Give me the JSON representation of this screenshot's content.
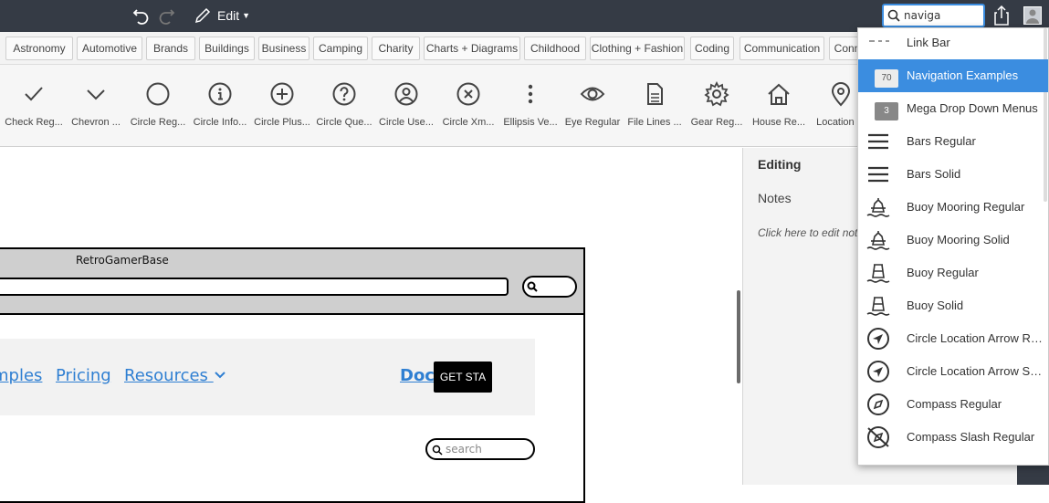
{
  "toolbar": {
    "edit_label": "Edit",
    "search_value": "naviga"
  },
  "categories": [
    "Astronomy",
    "Automotive",
    "Brands",
    "Buildings",
    "Business",
    "Camping",
    "Charity",
    "Charts + Diagrams",
    "Childhood",
    "Clothing + Fashion",
    "Coding",
    "Communication",
    "Conn"
  ],
  "icons": [
    {
      "label": "Check Reg...",
      "icon": "check-icon"
    },
    {
      "label": "Chevron ...",
      "icon": "chevron-down-icon"
    },
    {
      "label": "Circle Reg...",
      "icon": "circle-icon"
    },
    {
      "label": "Circle Info...",
      "icon": "circle-info-icon"
    },
    {
      "label": "Circle Plus...",
      "icon": "circle-plus-icon"
    },
    {
      "label": "Circle Que...",
      "icon": "circle-question-icon"
    },
    {
      "label": "Circle Use...",
      "icon": "circle-user-icon"
    },
    {
      "label": "Circle Xm...",
      "icon": "circle-xmark-icon"
    },
    {
      "label": "Ellipsis Ve...",
      "icon": "ellipsis-vertical-icon"
    },
    {
      "label": "Eye Regular",
      "icon": "eye-icon"
    },
    {
      "label": "File Lines ...",
      "icon": "file-lines-icon"
    },
    {
      "label": "Gear Reg...",
      "icon": "gear-icon"
    },
    {
      "label": "House Re...",
      "icon": "house-icon"
    },
    {
      "label": "Location ...",
      "icon": "location-icon"
    }
  ],
  "wireframe": {
    "title": "RetroGamerBase",
    "links": [
      "mples",
      "Pricing",
      "Resources"
    ],
    "docs": "Docs",
    "cta": "GET STA",
    "search_placeholder": "search"
  },
  "panel": {
    "editing": "Editing",
    "notes": "Notes",
    "hint": "Click here to edit notes"
  },
  "dropdown": [
    {
      "label": "Link Bar",
      "icon": "link-bar-icon"
    },
    {
      "label": "Navigation Examples",
      "icon": "navigation-examples-icon",
      "badge": "70",
      "selected": true
    },
    {
      "label": "Mega Drop Down Menus",
      "icon": "mega-menu-icon",
      "badge": "3"
    },
    {
      "label": "Bars Regular",
      "icon": "bars-icon"
    },
    {
      "label": "Bars Solid",
      "icon": "bars-icon"
    },
    {
      "label": "Buoy Mooring Regular",
      "icon": "buoy-mooring-icon"
    },
    {
      "label": "Buoy Mooring Solid",
      "icon": "buoy-mooring-icon"
    },
    {
      "label": "Buoy Regular",
      "icon": "buoy-icon"
    },
    {
      "label": "Buoy Solid",
      "icon": "buoy-icon"
    },
    {
      "label": "Circle Location Arrow Regular",
      "icon": "circle-location-arrow-icon"
    },
    {
      "label": "Circle Location Arrow Solid",
      "icon": "circle-location-arrow-icon"
    },
    {
      "label": "Compass Regular",
      "icon": "compass-icon"
    },
    {
      "label": "Compass Slash Regular",
      "icon": "compass-slash-icon"
    }
  ],
  "colors": {
    "topbar": "#353b45",
    "accent": "#3b8de0",
    "link": "#2f7fd2"
  }
}
